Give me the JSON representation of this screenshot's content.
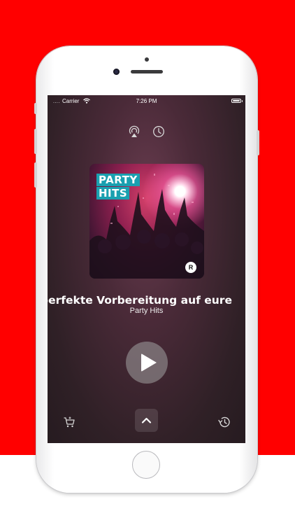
{
  "status_bar": {
    "signal": "....",
    "carrier": "Carrier",
    "time": "7:26 PM"
  },
  "player": {
    "cover_label_line1": "PARTY",
    "cover_label_line2": "HITS",
    "cover_badge": "R",
    "track_title": "perfekte Vorbereitung auf eure",
    "station_name": "Party Hits"
  },
  "icons": {
    "top_left": "airplay-icon",
    "top_right": "sleep-timer-icon",
    "bottom_left": "cart-icon",
    "bottom_center": "chevron-up-icon",
    "bottom_right": "history-icon",
    "center": "play-icon"
  },
  "colors": {
    "background": "#ff0000",
    "cover_label": "#1aa0b0"
  }
}
